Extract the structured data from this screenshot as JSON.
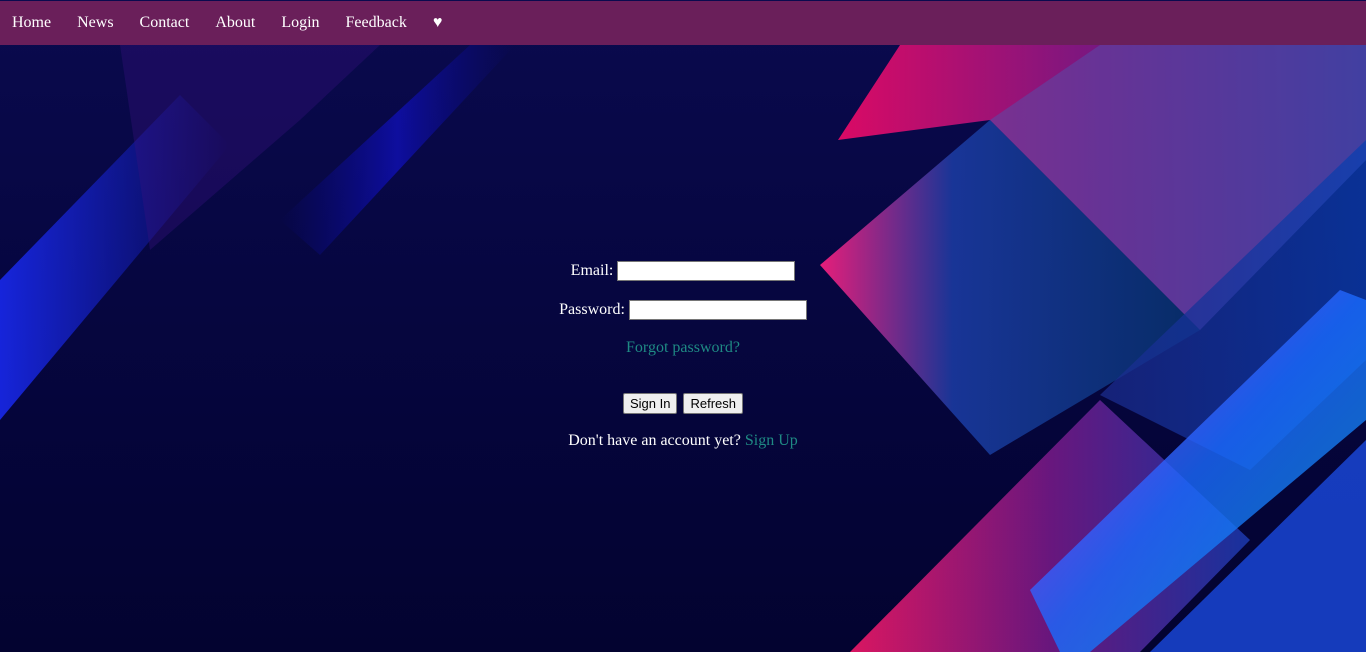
{
  "nav": {
    "items": [
      "Home",
      "News",
      "Contact",
      "About",
      "Login",
      "Feedback"
    ],
    "heart_label": "♥"
  },
  "login": {
    "email_label": "Email:",
    "email_value": "",
    "password_label": "Password:",
    "password_value": "",
    "forgot_link": "Forgot password?",
    "sign_in_button": "Sign In",
    "refresh_button": "Refresh",
    "no_account_text": "Don't have an account yet?",
    "sign_up_link": "Sign Up"
  },
  "colors": {
    "navbar": "#6a1f5a",
    "link": "#1f8a84",
    "background": "#060640"
  }
}
